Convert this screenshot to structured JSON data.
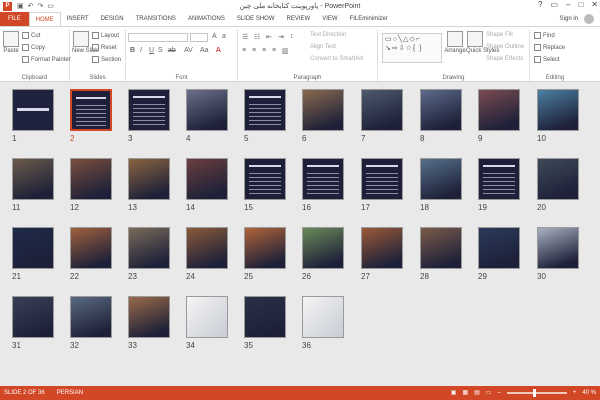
{
  "window": {
    "title": "پاورپوینت کتابخانه ملی چین - PowerPoint",
    "controls": [
      "?",
      "▭",
      "–",
      "□",
      "✕"
    ]
  },
  "tabs": [
    "FILE",
    "HOME",
    "INSERT",
    "DESIGN",
    "TRANSITIONS",
    "ANIMATIONS",
    "SLIDE SHOW",
    "REVIEW",
    "VIEW",
    "FILEminimizer"
  ],
  "signin": "Sign in",
  "ribbon": {
    "clipboard": {
      "label": "Clipboard",
      "paste": "Paste",
      "cut": "Cut",
      "copy": "Copy",
      "format_painter": "Format Painter"
    },
    "slides": {
      "label": "Slides",
      "new_slide": "New Slide",
      "layout": "Layout",
      "reset": "Reset",
      "section": "Section"
    },
    "font": {
      "label": "Font"
    },
    "paragraph": {
      "label": "Paragraph",
      "text_direction": "Text Direction",
      "align_text": "Align Text",
      "convert_smartart": "Convert to SmartArt"
    },
    "drawing": {
      "label": "Drawing",
      "arrange": "Arrange",
      "quick_styles": "Quick Styles",
      "shape_fill": "Shape Fill",
      "shape_outline": "Shape Outline",
      "shape_effects": "Shape Effects"
    },
    "editing": {
      "label": "Editing",
      "find": "Find",
      "replace": "Replace",
      "select": "Select"
    }
  },
  "slides": [
    {
      "n": "1",
      "kind": "title"
    },
    {
      "n": "2",
      "kind": "text",
      "selected": true
    },
    {
      "n": "3",
      "kind": "text"
    },
    {
      "n": "4",
      "kind": "photo",
      "color": "#6b6f88"
    },
    {
      "n": "5",
      "kind": "text"
    },
    {
      "n": "6",
      "kind": "photo",
      "color": "#8a6a4f"
    },
    {
      "n": "7",
      "kind": "photo",
      "color": "#4e5a6e"
    },
    {
      "n": "8",
      "kind": "photo",
      "color": "#5c6a8a"
    },
    {
      "n": "9",
      "kind": "photo",
      "color": "#7a4b52"
    },
    {
      "n": "10",
      "kind": "photo",
      "color": "#4d7fa2"
    },
    {
      "n": "11",
      "kind": "photo",
      "color": "#6b5a4a"
    },
    {
      "n": "12",
      "kind": "photo",
      "color": "#7a4e3e"
    },
    {
      "n": "13",
      "kind": "photo",
      "color": "#8a6440"
    },
    {
      "n": "14",
      "kind": "photo",
      "color": "#6a3e3e"
    },
    {
      "n": "15",
      "kind": "text"
    },
    {
      "n": "16",
      "kind": "text"
    },
    {
      "n": "17",
      "kind": "text"
    },
    {
      "n": "18",
      "kind": "photo",
      "color": "#56708a"
    },
    {
      "n": "19",
      "kind": "text"
    },
    {
      "n": "20",
      "kind": "photo",
      "color": "#3e4a58"
    },
    {
      "n": "21",
      "kind": "photo",
      "color": "#1e2a4a"
    },
    {
      "n": "22",
      "kind": "photo",
      "color": "#a0603e"
    },
    {
      "n": "23",
      "kind": "photo",
      "color": "#7a6a5a"
    },
    {
      "n": "24",
      "kind": "photo",
      "color": "#8a5a3a"
    },
    {
      "n": "25",
      "kind": "photo",
      "color": "#b0643a"
    },
    {
      "n": "26",
      "kind": "photo",
      "color": "#6a8a5a"
    },
    {
      "n": "27",
      "kind": "photo",
      "color": "#9a5a3a"
    },
    {
      "n": "28",
      "kind": "photo",
      "color": "#7a5a4a"
    },
    {
      "n": "29",
      "kind": "photo",
      "color": "#2a3a5a"
    },
    {
      "n": "30",
      "kind": "photo",
      "color": "#a8b0c0"
    },
    {
      "n": "31",
      "kind": "photo",
      "color": "#3a3f58"
    },
    {
      "n": "32",
      "kind": "photo",
      "color": "#5a6a80"
    },
    {
      "n": "33",
      "kind": "photo",
      "color": "#9a6a4a"
    },
    {
      "n": "34",
      "kind": "light"
    },
    {
      "n": "35",
      "kind": "photo",
      "color": "#2a3048"
    },
    {
      "n": "36",
      "kind": "light"
    }
  ],
  "status": {
    "slide_info": "SLIDE 2 OF 36",
    "language": "PERSIAN",
    "zoom": "40 %"
  },
  "colors": {
    "accent": "#d24726",
    "slide_bg": "#1d2038"
  }
}
